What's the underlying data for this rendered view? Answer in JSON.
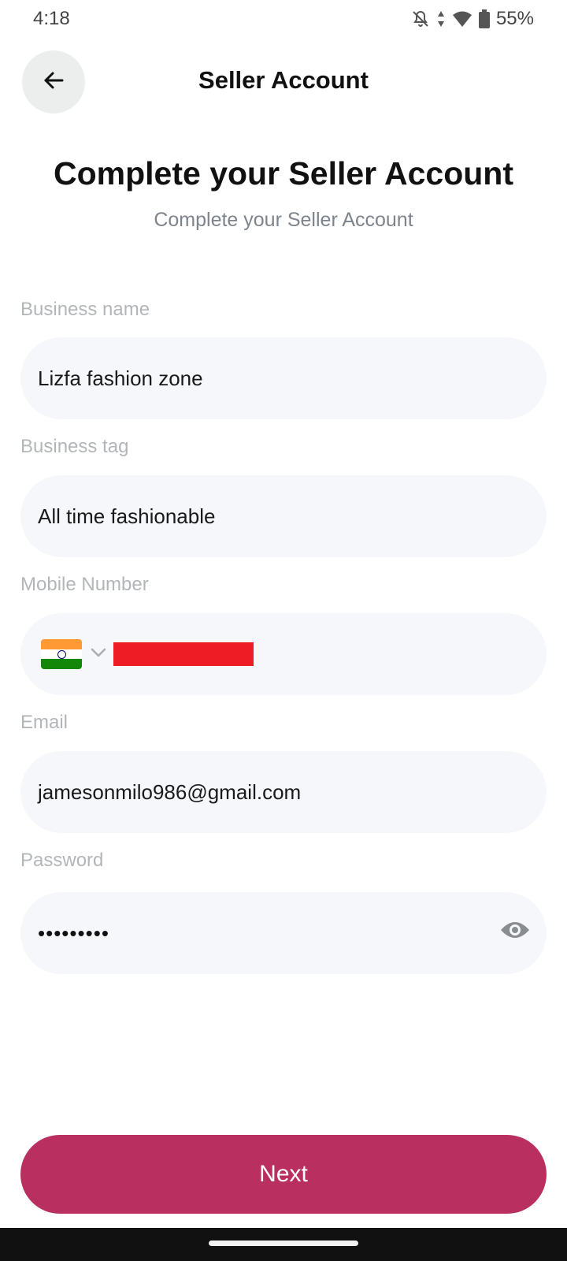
{
  "status_bar": {
    "time": "4:18",
    "battery_percent": "55%",
    "icons": [
      "notifications-off-icon",
      "data-arrows-icon",
      "wifi-icon",
      "battery-icon"
    ]
  },
  "app_bar": {
    "back_icon": "arrow-left-icon",
    "title": "Seller Account"
  },
  "header": {
    "title": "Complete your Seller Account",
    "subtitle": "Complete your Seller Account"
  },
  "form": {
    "business_name": {
      "label": "Business name",
      "value": "Lizfa fashion zone"
    },
    "business_tag": {
      "label": "Business tag",
      "value": "All time fashionable"
    },
    "mobile_number": {
      "label": "Mobile Number",
      "country_flag_icon": "india-flag-icon",
      "dropdown_icon": "chevron-down-icon",
      "value_redacted": true
    },
    "email": {
      "label": "Email",
      "value": "jamesonmilo986@gmail.com"
    },
    "password": {
      "label": "Password",
      "masked_value": "•••••••••",
      "toggle_icon": "eye-icon"
    }
  },
  "actions": {
    "next_label": "Next"
  },
  "colors": {
    "accent": "#b93060",
    "field_background": "#f6f7fb",
    "label": "#b3b6b9",
    "redaction": "#ee1c25"
  }
}
